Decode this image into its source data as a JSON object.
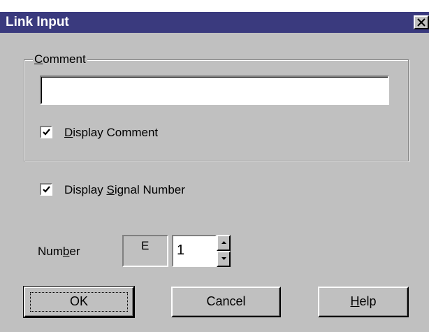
{
  "window": {
    "title": "Link Input"
  },
  "comment_group": {
    "legend_first": "C",
    "legend_rest": "omment",
    "comment_value": "",
    "display_comment": {
      "checked": true,
      "label_first": "D",
      "label_rest": "isplay Comment"
    }
  },
  "display_signal_number": {
    "checked": true,
    "label_before": "Display ",
    "label_ul": "S",
    "label_after": "ignal Number"
  },
  "number": {
    "label_before": "Num",
    "label_ul": "b",
    "label_after": "er",
    "prefix": "E",
    "value": "1"
  },
  "buttons": {
    "ok": "OK",
    "cancel": "Cancel",
    "help_ul": "H",
    "help_rest": "elp"
  },
  "colors": {
    "titlebar": "#3a3a7e",
    "dialog_face": "#c0c0c0"
  }
}
